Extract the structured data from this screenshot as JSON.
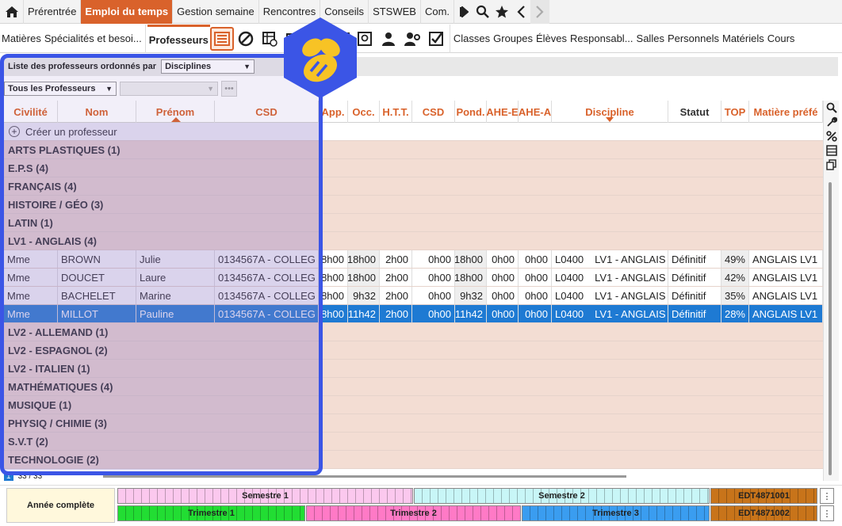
{
  "topbar": {
    "tabs": [
      "Prérentrée",
      "Emploi du temps",
      "Gestion semaine",
      "Rencontres",
      "Conseils",
      "STSWEB",
      "Com."
    ],
    "active_tab": "Emploi du temps"
  },
  "subbar": {
    "left_tabs": [
      "Matières",
      "Spécialités et besoi...",
      "Professeurs"
    ],
    "active_tab": "Professeurs",
    "right_tabs": [
      "Classes",
      "Groupes",
      "Élèves",
      "Responsabl...",
      "Salles",
      "Personnels",
      "Matériels",
      "Cours"
    ]
  },
  "filter": {
    "order_label": "Liste des professeurs ordonnés par",
    "order_value": "Disciplines",
    "profs_value": "Tous les Professeurs",
    "dots_label": "•••"
  },
  "table": {
    "headers": {
      "civilite": "Civilité",
      "nom": "Nom",
      "prenom": "Prénom",
      "csd": "CSD",
      "app": "App.",
      "occ": "Occ.",
      "htt": "H.T.T.",
      "csd2": "CSD",
      "pond": "Pond.",
      "ahee": "AHE-E",
      "ahea": "AHE-A",
      "discipline": "Discipline",
      "statut": "Statut",
      "top": "TOP",
      "matiere": "Matière préfé"
    },
    "create_label": "Créer un professeur",
    "groups_before": [
      "ARTS PLASTIQUES (1)",
      "E.P.S (4)",
      "FRANÇAIS (4)",
      "HISTOIRE / GÉO (3)",
      "LATIN (1)",
      "LV1 - ANGLAIS (4)"
    ],
    "rows": [
      {
        "civ": "Mme",
        "nom": "BROWN",
        "prenom": "Julie",
        "csd": "0134567A - COLLEG",
        "app": "18h00",
        "occ": "18h00",
        "htt": "2h00",
        "csd2": "0h00",
        "pond": "18h00",
        "ahee": "0h00",
        "ahea": "0h00",
        "code": "L0400",
        "disc": "LV1 - ANGLAIS",
        "statut": "Définitif",
        "top": "49%",
        "mat": "ANGLAIS LV1"
      },
      {
        "civ": "Mme",
        "nom": "DOUCET",
        "prenom": "Laure",
        "csd": "0134567A - COLLEG",
        "app": "18h00",
        "occ": "18h00",
        "htt": "2h00",
        "csd2": "0h00",
        "pond": "18h00",
        "ahee": "0h00",
        "ahea": "0h00",
        "code": "L0400",
        "disc": "LV1 - ANGLAIS",
        "statut": "Définitif",
        "top": "42%",
        "mat": "ANGLAIS LV1"
      },
      {
        "civ": "Mme",
        "nom": "BACHELET",
        "prenom": "Marine",
        "csd": "0134567A - COLLEG",
        "app": "18h00",
        "occ": "9h32",
        "htt": "2h00",
        "csd2": "0h00",
        "pond": "9h32",
        "ahee": "0h00",
        "ahea": "0h00",
        "code": "L0400",
        "disc": "LV1 - ANGLAIS",
        "statut": "Définitif",
        "top": "35%",
        "mat": "ANGLAIS LV1"
      },
      {
        "civ": "Mme",
        "nom": "MILLOT",
        "prenom": "Pauline",
        "csd": "0134567A - COLLEG",
        "app": "18h00",
        "occ": "11h42",
        "htt": "2h00",
        "csd2": "0h00",
        "pond": "11h42",
        "ahee": "0h00",
        "ahea": "0h00",
        "code": "L0400",
        "disc": "LV1 - ANGLAIS",
        "statut": "Définitif",
        "top": "28%",
        "mat": "ANGLAIS LV1"
      }
    ],
    "groups_after": [
      "LV2 - ALLEMAND (1)",
      "LV2 - ESPAGNOL (2)",
      "LV2 - ITALIEN (1)",
      "MATHÉMATIQUES (4)",
      "MUSIQUE (1)",
      "PHYSIQ / CHIMIE (3)",
      "S.V.T (2)",
      "TECHNOLOGIE (2)"
    ]
  },
  "pager": {
    "page": "1",
    "count": "33 / 33"
  },
  "periods": {
    "annee": "Année complète",
    "semestre1": "Semestre 1",
    "semestre2": "Semestre 2",
    "trimestre1": "Trimestre 1",
    "trimestre2": "Trimestre 2",
    "trimestre3": "Trimestre 3",
    "edt1": "EDT4871001",
    "edt2": "EDT4871002"
  },
  "colors": {
    "accent": "#d9622b",
    "selection": "#1e7ad3",
    "overlay": "#3b55e6",
    "group_bg": "#f3ddd3"
  }
}
